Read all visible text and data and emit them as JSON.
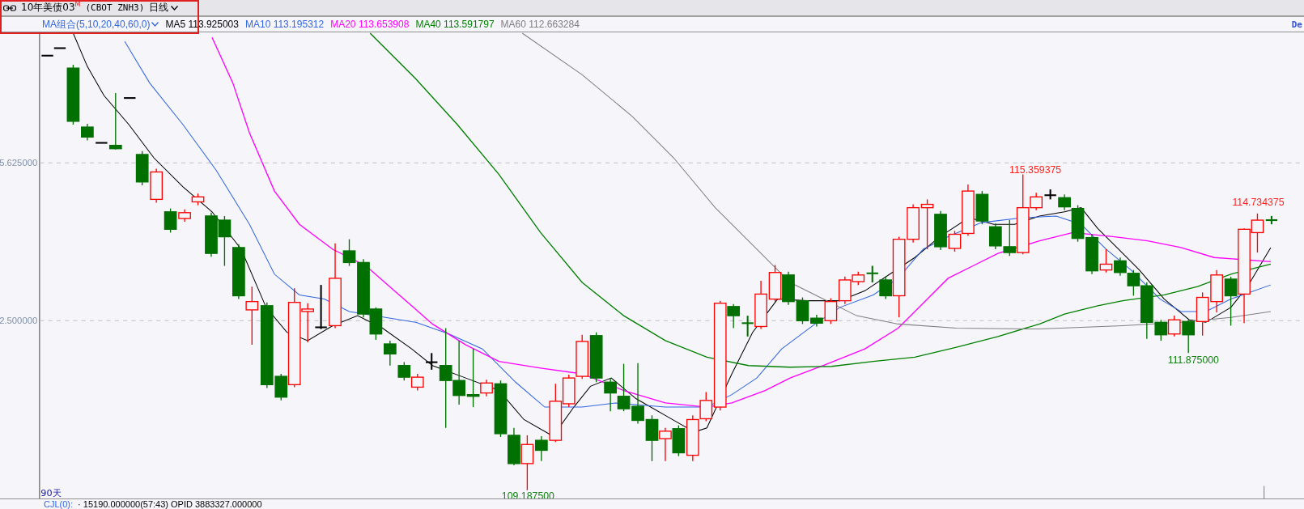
{
  "header": {
    "title": "10年美债03",
    "title_mark": "M",
    "symbol": "(CBOT ZNH3)",
    "period": "日线"
  },
  "ma_bar": {
    "combo": "MA组合(5,10,20,40,60,0)",
    "indicators": [
      {
        "label": "MA5",
        "value": "113.925003",
        "color": "#000000"
      },
      {
        "label": "MA10",
        "value": "113.195312",
        "color": "#3366e0"
      },
      {
        "label": "MA20",
        "value": "113.653908",
        "color": "#ff00ff"
      },
      {
        "label": "MA40",
        "value": "113.591797",
        "color": "#008000"
      },
      {
        "label": "MA60",
        "value": "112.663284",
        "color": "#808080"
      }
    ]
  },
  "corner_text": "De",
  "chart": {
    "y_labels": [
      "5.625000",
      "2.500000"
    ],
    "annotations": [
      {
        "text": "115.359375",
        "kind": "high"
      },
      {
        "text": "114.734375",
        "kind": "high"
      },
      {
        "text": "111.875000",
        "kind": "low"
      },
      {
        "text": "109.187500",
        "kind": "low"
      }
    ],
    "range_label": "90天"
  },
  "status_line": {
    "label": "CJL(0):",
    "text": "· 15190.000000(57:43)  OPID 3883327.000000"
  }
}
